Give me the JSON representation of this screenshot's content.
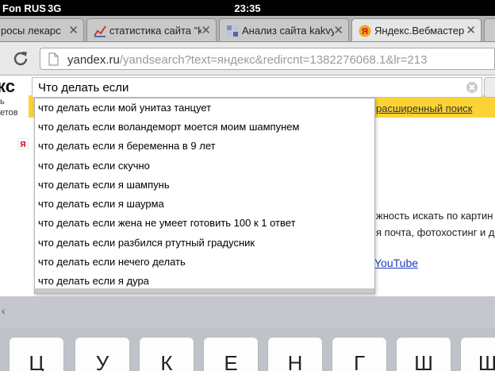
{
  "status_bar": {
    "carrier": "Fon RUS",
    "network": "3G",
    "time": "23:35"
  },
  "tabs": [
    {
      "title": "росы лекарств",
      "favicon": "none",
      "active": false
    },
    {
      "title": "статистика сайта \"k",
      "favicon": "chart-icon",
      "active": false
    },
    {
      "title": "Анализ сайта kakvy",
      "favicon": "grid-icon",
      "active": false
    },
    {
      "title": "Яндекс.Вебмастер",
      "favicon": "yandex-icon",
      "active": true
    },
    {
      "title": "",
      "favicon": "none",
      "active": false
    }
  ],
  "address_bar": {
    "host": "yandex.ru",
    "path": "/yandsearch?text=яндекс&redircnt=1382276068.1&lr=213"
  },
  "page": {
    "logo_text": "кс",
    "logo_sub1": "ь",
    "logo_sub2": "етов",
    "search_value": "Что делать если",
    "advanced_search": "расширенный поиск",
    "promo_line1": "жность искать по картин",
    "promo_line2": "я почта, фотохостинг и д",
    "youtube": "YouTube"
  },
  "suggestions": [
    "что делать если мой унитаз танцует",
    "что делать если воландеморт моется моим шампунем",
    "что делать если я беременна в 9 лет",
    "что делать если скучно",
    "что делать если я шампунь",
    "что делать если я шаурма",
    "что делать если жена не умеет готовить 100 к 1 ответ",
    "что делать если разбился ртутный градусник",
    "что делать если нечего делать",
    "что делать если я дура"
  ],
  "keyboard": {
    "keys": [
      "Ц",
      "У",
      "К",
      "Е",
      "Н",
      "Г",
      "Ш",
      "Щ"
    ]
  },
  "colors": {
    "yandex_yellow": "#fbd335",
    "link_blue": "#1a3dc1",
    "status_bar": "#000000"
  }
}
